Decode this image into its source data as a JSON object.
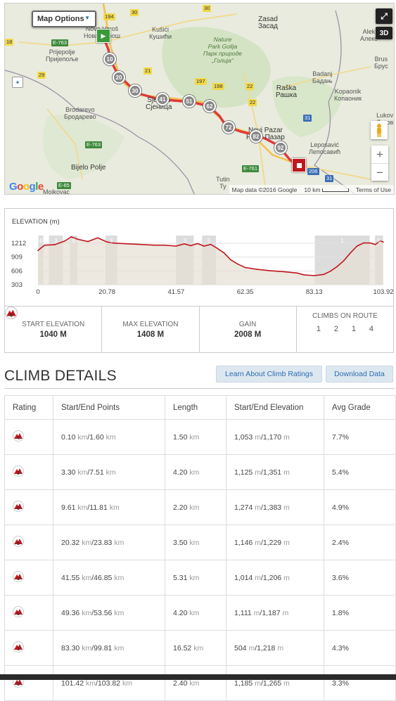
{
  "map": {
    "options_label": "Map Options",
    "btn_3d": "3D",
    "google_logo": "Google",
    "map_data": "Map data ©2016 Google",
    "scale": "10 km",
    "terms": "Terms of Use",
    "labels": {
      "nova_varos": "Nova Varoš\nНова Варош",
      "kusici": "Kušići\nКушићи",
      "zasad": "Zasad\nЗасад",
      "aleksandrovac": "Alek\nАлекс",
      "prijepolje": "Prijepolje\nПријепоље",
      "park": "Nature\nPark Golija\nПарк природе\n„Голија“",
      "sjenica": "Sjenica\nСјеница",
      "raska": "Raška\nРашка",
      "badanj": "Badanj\nБадањ",
      "kopaonik": "Kopaonik\nКопаоник",
      "brus": "Brus\nБрус",
      "brodarevo": "Brodarevo\nБродарево",
      "novi_pazar": "Novi Pazar\nНови Пазар",
      "lukovo": "Lukov\nЛуков",
      "leposavic": "Leposavić\nЛепосавић",
      "bijelo_polje": "Bijelo Polje",
      "tutin": "Tutin\nТу",
      "mojkovac": "Mojkovac"
    },
    "roads": [
      "194",
      "30",
      "E-763",
      "29",
      "21",
      "197",
      "198",
      "22",
      "30",
      "E-763",
      "E-65",
      "E-761",
      "22",
      "206",
      "31",
      "31",
      "E-80",
      "18",
      "E-763"
    ],
    "markers": [
      "10",
      "20",
      "30",
      "41",
      "51",
      "62",
      "72",
      "82",
      "92"
    ]
  },
  "elevation": {
    "title": "ELEVATION (m)",
    "y_ticks": [
      "1212",
      "909",
      "606",
      "303"
    ],
    "x_ticks": [
      "0",
      "20.78",
      "41.57",
      "62.35",
      "83.13",
      "103.92"
    ],
    "climb_tags": [
      "4",
      "3",
      "5",
      "5",
      "3",
      "5",
      "1"
    ],
    "start_label": "START ELEVATION",
    "start_value": "1040 M",
    "max_label": "MAX ELEVATION",
    "max_value": "1408 M",
    "gain_label": "GAIN",
    "gain_value": "2008 M",
    "climbs_label": "CLIMBS ON ROUTE",
    "climb_counts": [
      {
        "cat": "1",
        "count": "1"
      },
      {
        "cat": "3",
        "count": "2"
      },
      {
        "cat": "4",
        "count": "1"
      },
      {
        "cat": "5",
        "count": "4"
      }
    ]
  },
  "chart_data": {
    "type": "area",
    "title": "ELEVATION (m)",
    "xlabel": "",
    "ylabel": "",
    "x_unit": "km",
    "xlim": [
      0,
      103.92
    ],
    "ylim": [
      303,
      1400
    ],
    "x": [
      0,
      2,
      5,
      8,
      10,
      12,
      15,
      18,
      20.78,
      23,
      27,
      30,
      35,
      38,
      41.57,
      44,
      46,
      48,
      50,
      52,
      54,
      56,
      58,
      60,
      62.35,
      66,
      70,
      74,
      78,
      80,
      83.13,
      86,
      88,
      90,
      92,
      94,
      96,
      98,
      100,
      101.5,
      103,
      103.92
    ],
    "y": [
      1053,
      1170,
      1180,
      1260,
      1351,
      1300,
      1250,
      1330,
      1240,
      1215,
      1200,
      1190,
      1170,
      1170,
      1150,
      1200,
      1160,
      1206,
      1150,
      1187,
      1100,
      1000,
      850,
      760,
      680,
      640,
      610,
      590,
      560,
      520,
      504,
      530,
      600,
      700,
      830,
      1000,
      1150,
      1220,
      1218,
      1185,
      1265,
      1240
    ],
    "series": [
      {
        "values": [
          1053,
          1170,
          1180,
          1260,
          1351,
          1300,
          1250,
          1330,
          1240,
          1215,
          1200,
          1190,
          1170,
          1170,
          1150,
          1200,
          1160,
          1206,
          1150,
          1187,
          1100,
          1000,
          850,
          760,
          680,
          640,
          610,
          590,
          560,
          520,
          504,
          530,
          600,
          700,
          830,
          1000,
          1150,
          1220,
          1218,
          1185,
          1265,
          1240
        ]
      }
    ],
    "climb_ranges": [
      {
        "cat": "4",
        "start": 0.1,
        "end": 1.6
      },
      {
        "cat": "3",
        "start": 3.3,
        "end": 7.51
      },
      {
        "cat": "5",
        "start": 9.61,
        "end": 11.81
      },
      {
        "cat": "5",
        "start": 20.32,
        "end": 23.83
      },
      {
        "cat": "3",
        "start": 41.55,
        "end": 46.85
      },
      {
        "cat": "5",
        "start": 49.36,
        "end": 53.56
      },
      {
        "cat": "1",
        "start": 83.3,
        "end": 99.81
      },
      {
        "cat": "5",
        "start": 101.42,
        "end": 103.82
      }
    ],
    "grid": true,
    "colors": {
      "line": "#c0161e",
      "fill": "#e6e0d4",
      "climb_band": "#d6d6d6"
    }
  },
  "climb_details": {
    "title": "CLIMB DETAILS",
    "learn_button": "Learn About Climb Ratings",
    "download_button": "Download Data",
    "headers": [
      "Rating",
      "Start/End Points",
      "Length",
      "Start/End Elevation",
      "Avg Grade"
    ],
    "rows": [
      {
        "rating": "4",
        "start": "0.10",
        "end": "1.60",
        "length": "1.50",
        "elev_start": "1,053",
        "elev_end": "1,170",
        "grade": "7.7%"
      },
      {
        "rating": "3",
        "start": "3.30",
        "end": "7.51",
        "length": "4.20",
        "elev_start": "1,125",
        "elev_end": "1,351",
        "grade": "5.4%"
      },
      {
        "rating": "5",
        "start": "9.61",
        "end": "11.81",
        "length": "2.20",
        "elev_start": "1,274",
        "elev_end": "1,383",
        "grade": "4.9%"
      },
      {
        "rating": "5",
        "start": "20.32",
        "end": "23.83",
        "length": "3.50",
        "elev_start": "1,146",
        "elev_end": "1,229",
        "grade": "2.4%"
      },
      {
        "rating": "3",
        "start": "41.55",
        "end": "46.85",
        "length": "5.31",
        "elev_start": "1,014",
        "elev_end": "1,206",
        "grade": "3.6%"
      },
      {
        "rating": "5",
        "start": "49.36",
        "end": "53.56",
        "length": "4.20",
        "elev_start": "1,111",
        "elev_end": "1,187",
        "grade": "1.8%"
      },
      {
        "rating": "1",
        "start": "83.30",
        "end": "99.81",
        "length": "16.52",
        "elev_start": "504",
        "elev_end": "1,218",
        "grade": "4.3%"
      },
      {
        "rating": "5",
        "start": "101.42",
        "end": "103.82",
        "length": "2.40",
        "elev_start": "1,185",
        "elev_end": "1,265",
        "grade": "3.3%"
      }
    ],
    "units": {
      "km": "km",
      "m": "m"
    }
  },
  "colors": {
    "accent": "#2a6db0",
    "route": "#c0161e",
    "button_bg": "#dde7f0"
  }
}
